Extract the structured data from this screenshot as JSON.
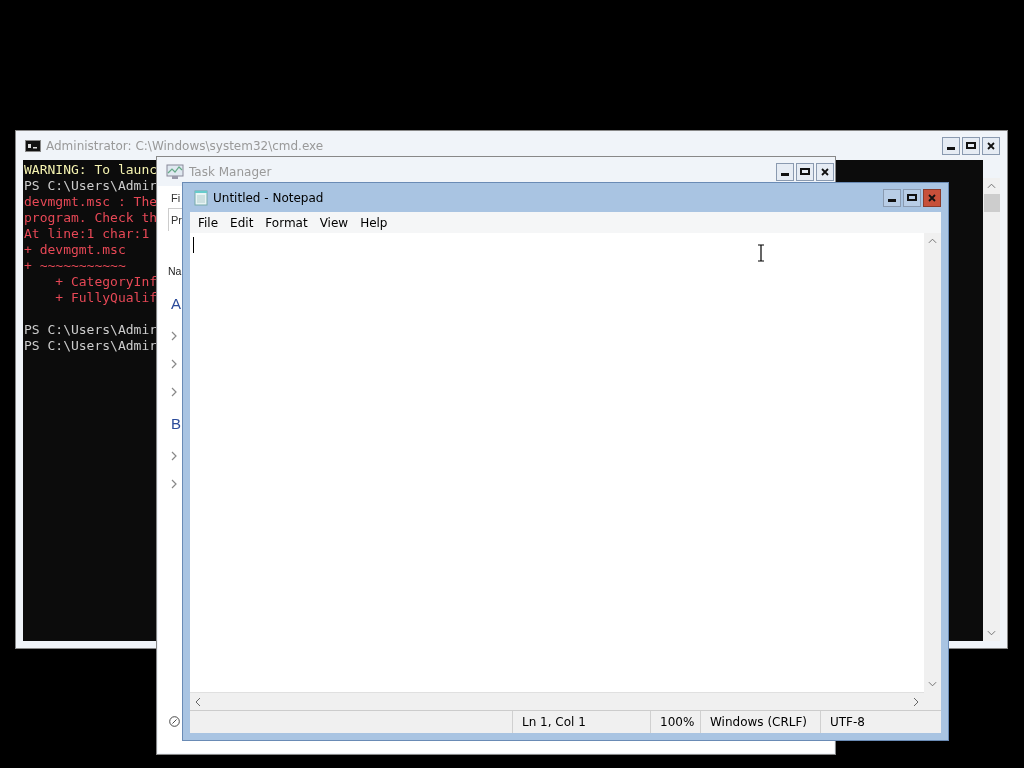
{
  "windows": [
    {
      "kind": "console",
      "title": "Administrator: C:\\Windows\\system32\\cmd.exe",
      "active": false,
      "blocks": [
        [
          {
            "kind": "warning",
            "text": "WARNING: To launc"
          },
          {
            "kind": "prompt",
            "text": "PS C:\\Users\\Admir"
          },
          {
            "kind": "error",
            "text": "devmgmt.msc : The"
          },
          {
            "kind": "error",
            "text": "program. Check th"
          },
          {
            "kind": "error",
            "text": "At line:1 char:1"
          },
          {
            "kind": "error",
            "text": "+ devmgmt.msc"
          },
          {
            "kind": "error",
            "text": "+ ~~~~~~~~~~~"
          },
          {
            "kind": "error",
            "text": "    + CategoryInf"
          },
          {
            "kind": "error",
            "text": "    + FullyQualif"
          }
        ],
        [
          {
            "kind": "prompt",
            "text": "PS C:\\Users\\Admir"
          },
          {
            "kind": "prompt",
            "text": "PS C:\\Users\\Admir"
          }
        ]
      ]
    },
    {
      "kind": "taskmanager",
      "title": "Task Manager",
      "active": false,
      "menu": "Fi",
      "tab": "Pr",
      "column": "Na",
      "groups": [
        {
          "label": "A",
          "rows": [
            {
              "expanded": false
            },
            {
              "expanded": false
            },
            {
              "expanded": false
            }
          ]
        },
        {
          "label": "B",
          "rows": [
            {
              "expanded": false
            },
            {
              "expanded": false
            }
          ]
        }
      ]
    },
    {
      "kind": "notepad",
      "title": "Untitled - Notepad",
      "active": true,
      "menu": [
        "File",
        "Edit",
        "Format",
        "View",
        "Help"
      ],
      "status": [
        "Ln 1, Col 1",
        "100%",
        "Windows (CRLF)",
        "UTF-8"
      ]
    }
  ]
}
